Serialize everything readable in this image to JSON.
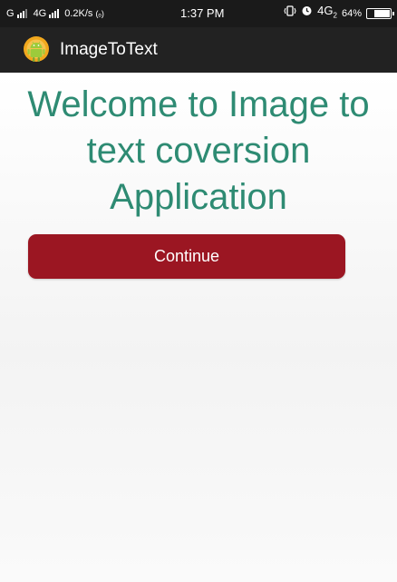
{
  "status_bar": {
    "carrier1": "G",
    "carrier2": "4G",
    "data_speed": "0.2K/s",
    "hotspot_icon": "(ₒ)",
    "time": "1:37 PM",
    "vibrate_icon": "vibrate-icon",
    "alarm_icon": "alarm-icon",
    "network_type": "4G",
    "network_sub": "2",
    "battery_percent": "64%",
    "battery_level": 0.64
  },
  "app_bar": {
    "title": "ImageToText",
    "icon": "android-icon",
    "background": "#222222"
  },
  "main": {
    "heading": "Welcome to Image to text coversion Application",
    "continue_label": "Continue",
    "heading_color": "#2e8b73",
    "button_color": "#9b1622"
  }
}
